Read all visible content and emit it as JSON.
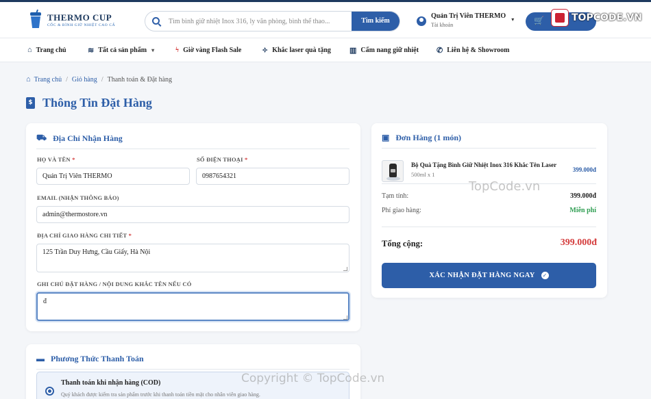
{
  "header": {
    "logo_title": "THERMO CUP",
    "logo_subtitle": "CỐC & BÌNH GIỮ NHIỆT CAO CẤ",
    "search_placeholder": "Tìm bình giữ nhiệt Inox 316, ly văn phòng, bình thể thao...",
    "search_button": "Tìm kiếm",
    "account_name": "Quản Trị Viên THERMO",
    "account_sub": "Tài khoản",
    "cart_icon": "cart-icon",
    "badge_text": "TOPCODE.VN"
  },
  "nav": {
    "home": "Trang chủ",
    "products": "Tất cả sản phẩm",
    "flash_sale": "Giờ vàng Flash Sale",
    "laser": "Khắc laser quà tặng",
    "guide": "Cẩm nang giữ nhiệt",
    "contact": "Liên hệ & Showroom"
  },
  "breadcrumb": {
    "home": "Trang chủ",
    "cart": "Giỏ hàng",
    "current": "Thanh toán & Đặt hàng"
  },
  "page_title": "Thông Tin Đặt Hàng",
  "address": {
    "heading": "Địa Chỉ Nhận Hàng",
    "name_label": "HỌ VÀ TÊN",
    "name_value": "Quản Trị Viên THERMO",
    "phone_label": "SỐ ĐIỆN THOẠI",
    "phone_value": "0987654321",
    "email_label": "EMAIL (NHẬN THÔNG BÁO)",
    "email_value": "admin@thermostore.vn",
    "addr_label": "ĐỊA CHỈ GIAO HÀNG CHI TIẾT",
    "addr_value": "125 Trần Duy Hưng, Cầu Giấy, Hà Nội",
    "note_label": "GHI CHÚ ĐẶT HÀNG / NỘI DUNG KHẮC TÊN NẾU CÓ",
    "note_value": "đ",
    "required_mark": "*"
  },
  "payment": {
    "heading": "Phương Thức Thanh Toán",
    "option_title": "Thanh toán khi nhận hàng (COD)",
    "option_desc": "Quý khách được kiểm tra sản phẩm trước khi thanh toán tiền mặt cho nhân viên giao hàng."
  },
  "order": {
    "heading": "Đơn Hàng (1 món)",
    "item_name": "Bộ Quà Tặng Bình Giữ Nhiệt Inox 316 Khắc Tên Laser",
    "item_meta": "500ml x 1",
    "item_price": "399.000đ",
    "subtotal_label": "Tạm tính:",
    "subtotal_value": "399.000đ",
    "shipping_label": "Phí giao hàng:",
    "shipping_value": "Miễn phí",
    "total_label": "Tổng cộng:",
    "total_value": "399.000đ",
    "confirm_button": "XÁC NHẬN ĐẶT HÀNG NGAY"
  },
  "watermarks": {
    "top": "TopCode.vn",
    "bottom": "Copyright © TopCode.vn"
  },
  "colors": {
    "primary": "#2d5ea8",
    "dark": "#1e3a5f",
    "danger": "#d43c3c",
    "success": "#2f9e52"
  }
}
